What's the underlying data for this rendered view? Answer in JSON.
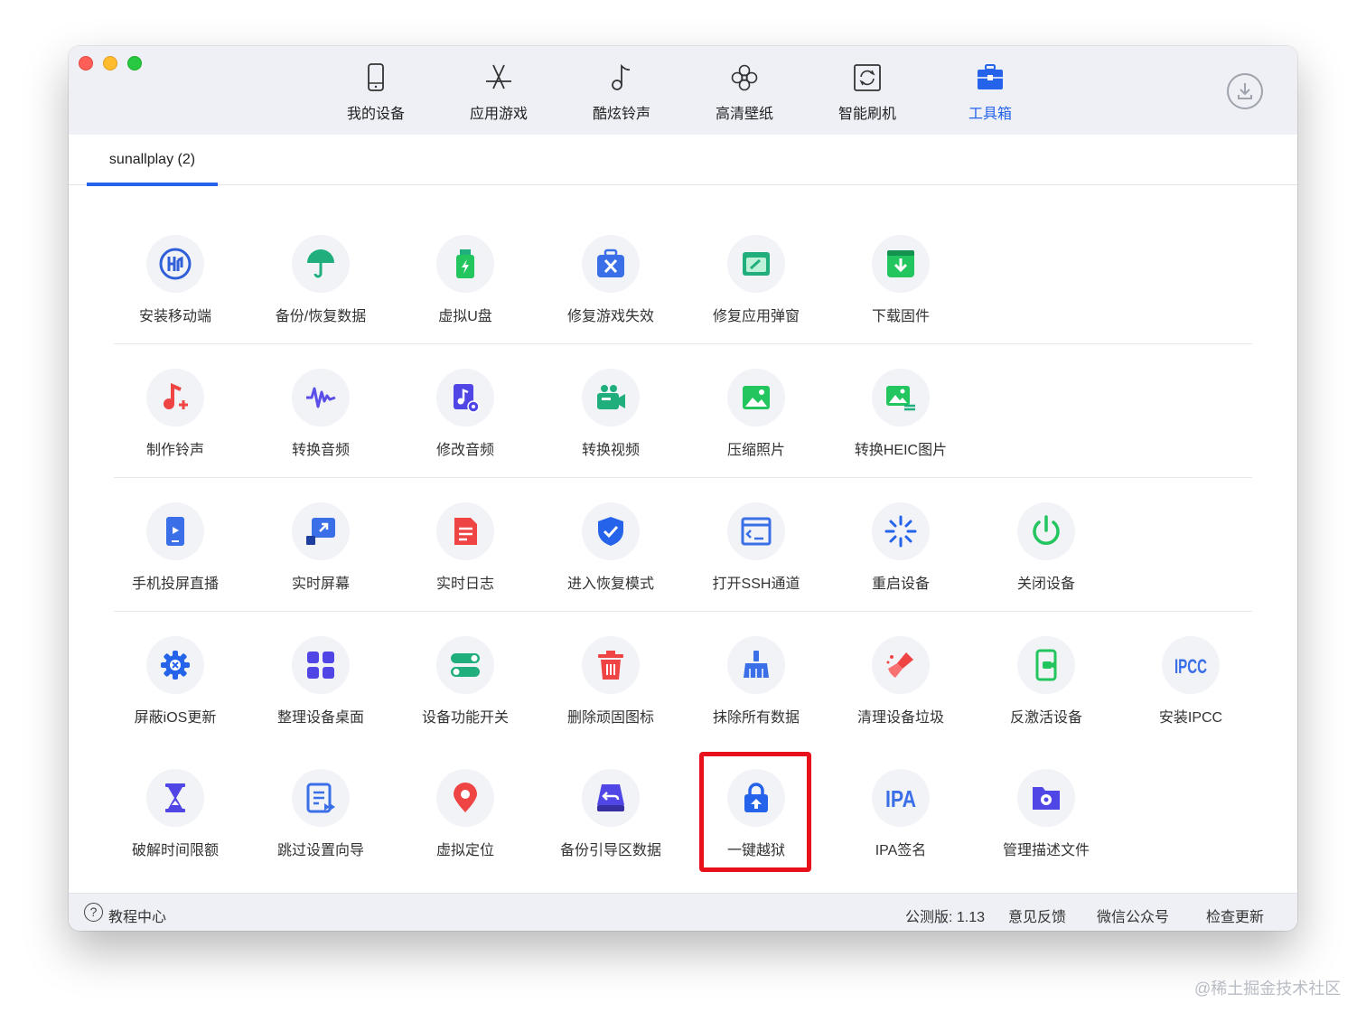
{
  "nav": {
    "items": [
      {
        "label": "我的设备",
        "icon": "phone-icon"
      },
      {
        "label": "应用游戏",
        "icon": "app-store-icon"
      },
      {
        "label": "酷炫铃声",
        "icon": "music-note-icon"
      },
      {
        "label": "高清壁纸",
        "icon": "flower-icon"
      },
      {
        "label": "智能刷机",
        "icon": "refresh-icon"
      },
      {
        "label": "工具箱",
        "icon": "toolbox-icon"
      }
    ],
    "active": "工具箱",
    "accent_color": "#2563eb"
  },
  "device_tab": {
    "label": "sunallplay (2)"
  },
  "tools": {
    "row1": [
      {
        "label": "安装移动端",
        "icon": "install-mobile-icon"
      },
      {
        "label": "备份/恢复数据",
        "icon": "umbrella-icon"
      },
      {
        "label": "虚拟U盘",
        "icon": "usb-drive-icon"
      },
      {
        "label": "修复游戏失效",
        "icon": "repair-game-icon"
      },
      {
        "label": "修复应用弹窗",
        "icon": "repair-app-icon"
      },
      {
        "label": "下载固件",
        "icon": "download-firmware-icon"
      }
    ],
    "row2": [
      {
        "label": "制作铃声",
        "icon": "make-ringtone-icon"
      },
      {
        "label": "转换音频",
        "icon": "audio-wave-icon"
      },
      {
        "label": "修改音频",
        "icon": "edit-audio-icon"
      },
      {
        "label": "转换视频",
        "icon": "video-camera-icon"
      },
      {
        "label": "压缩照片",
        "icon": "photo-icon"
      },
      {
        "label": "转换HEIC图片",
        "icon": "convert-image-icon"
      }
    ],
    "row3": [
      {
        "label": "手机投屏直播",
        "icon": "screen-cast-icon"
      },
      {
        "label": "实时屏幕",
        "icon": "live-screen-icon"
      },
      {
        "label": "实时日志",
        "icon": "log-icon"
      },
      {
        "label": "进入恢复模式",
        "icon": "shield-check-icon"
      },
      {
        "label": "打开SSH通道",
        "icon": "terminal-icon"
      },
      {
        "label": "重启设备",
        "icon": "restart-icon"
      },
      {
        "label": "关闭设备",
        "icon": "power-icon"
      }
    ],
    "row4": [
      {
        "label": "屏蔽iOS更新",
        "icon": "gear-block-icon"
      },
      {
        "label": "整理设备桌面",
        "icon": "grid-icon"
      },
      {
        "label": "设备功能开关",
        "icon": "toggle-icon"
      },
      {
        "label": "删除顽固图标",
        "icon": "trash-icon"
      },
      {
        "label": "抹除所有数据",
        "icon": "erase-icon"
      },
      {
        "label": "清理设备垃圾",
        "icon": "broom-icon"
      },
      {
        "label": "反激活设备",
        "icon": "deactivate-icon"
      },
      {
        "label": "安装IPCC",
        "icon": "ipcc-icon",
        "glyph": "IPCC"
      }
    ],
    "row5": [
      {
        "label": "破解时间限额",
        "icon": "hourglass-icon"
      },
      {
        "label": "跳过设置向导",
        "icon": "skip-setup-icon"
      },
      {
        "label": "虚拟定位",
        "icon": "location-pin-icon"
      },
      {
        "label": "备份引导区数据",
        "icon": "backup-boot-icon"
      },
      {
        "label": "一键越狱",
        "icon": "jailbreak-lock-icon"
      },
      {
        "label": "IPA签名",
        "icon": "ipa-icon",
        "glyph": "IPA"
      },
      {
        "label": "管理描述文件",
        "icon": "profile-folder-icon"
      }
    ]
  },
  "highlighted_tool": "一键越狱",
  "highlight_color": "#e8101a",
  "footer": {
    "help_label": "教程中心",
    "help_icon_glyph": "?",
    "version": "公测版: 1.13",
    "feedback": "意见反馈",
    "wechat": "微信公众号",
    "check_update": "检查更新"
  },
  "watermark": "@稀土掘金技术社区"
}
